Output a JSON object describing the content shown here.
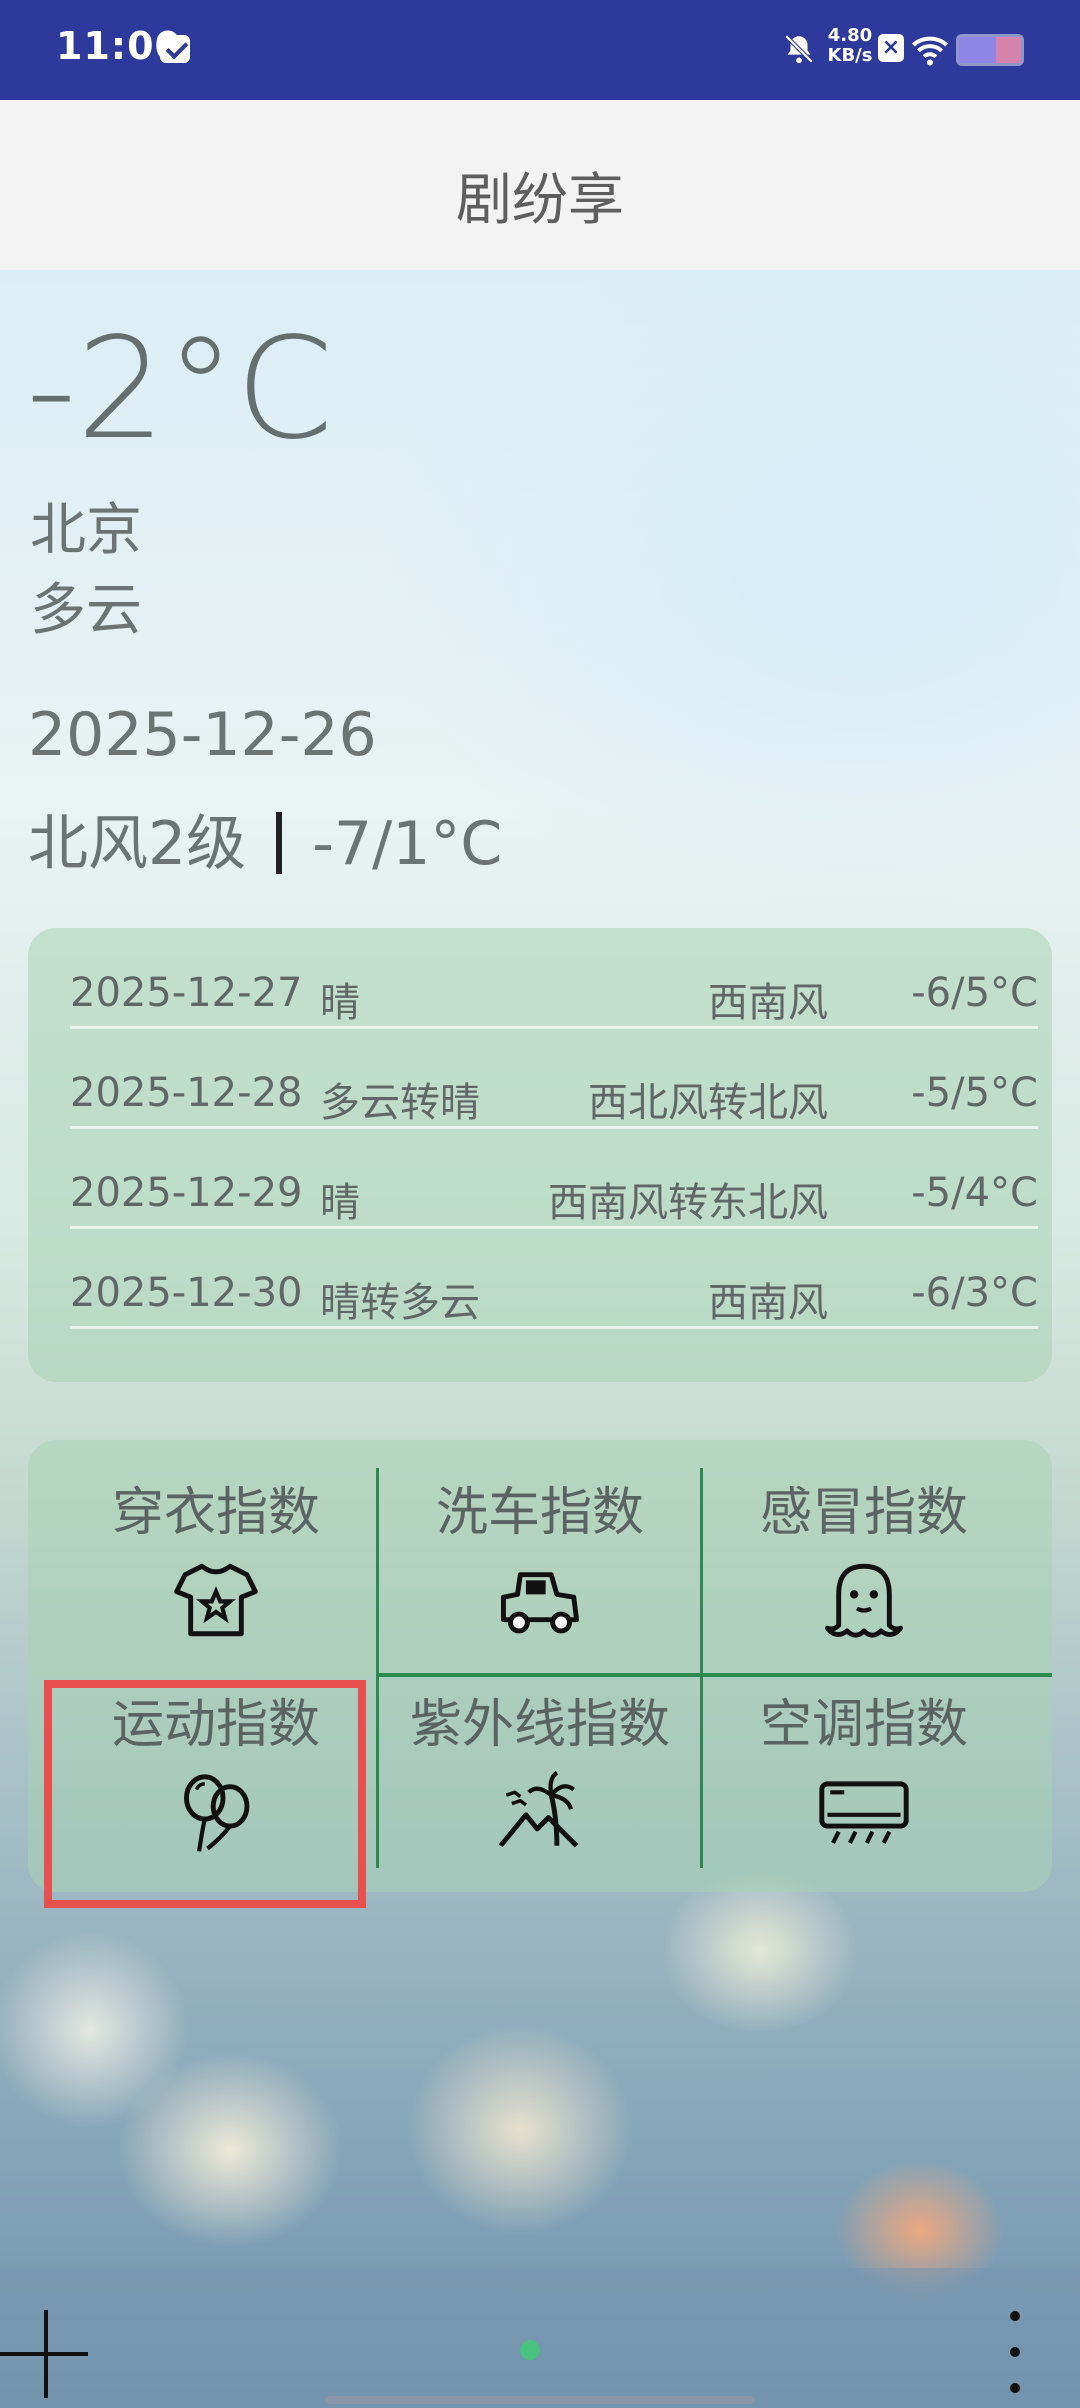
{
  "status_bar": {
    "time": "11:00",
    "net_speed_value": "4.80",
    "net_speed_unit": "KB/s",
    "icons": [
      "mail-icon",
      "bell-off-icon",
      "x-icon",
      "wifi-icon",
      "battery-icon"
    ]
  },
  "app_bar": {
    "title": "剧纷享"
  },
  "current": {
    "temperature": "-2°C",
    "city": "北京",
    "condition": "多云",
    "date": "2025-12-26",
    "wind": "北风2级",
    "range": "-7/1°C"
  },
  "forecast": [
    {
      "date": "2025-12-27",
      "condition": "晴",
      "wind": "西南风",
      "range": "-6/5°C"
    },
    {
      "date": "2025-12-28",
      "condition": "多云转晴",
      "wind": "西北风转北风",
      "range": "-5/5°C"
    },
    {
      "date": "2025-12-29",
      "condition": "晴",
      "wind": "西南风转东北风",
      "range": "-5/4°C"
    },
    {
      "date": "2025-12-30",
      "condition": "晴转多云",
      "wind": "西南风",
      "range": "-6/3°C"
    }
  ],
  "indices": [
    {
      "label": "穿衣指数",
      "icon": "tshirt-icon"
    },
    {
      "label": "洗车指数",
      "icon": "car-icon"
    },
    {
      "label": "感冒指数",
      "icon": "ghost-icon"
    },
    {
      "label": "运动指数",
      "icon": "balloons-icon"
    },
    {
      "label": "紫外线指数",
      "icon": "palm-mountain-icon"
    },
    {
      "label": "空调指数",
      "icon": "air-conditioner-icon"
    }
  ],
  "colors": {
    "status_bar": "#2e3a9b",
    "divider_green": "#2d8a4e",
    "highlight_red": "#e85050",
    "page_dot": "#48c27e"
  }
}
